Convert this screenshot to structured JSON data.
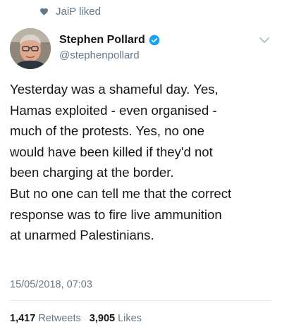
{
  "social_context": {
    "icon": "heart-icon",
    "text": "JaiP liked"
  },
  "author": {
    "name": "Stephen Pollard",
    "handle": "@stephenpollard",
    "verified": true,
    "verified_color": "#1da1f2"
  },
  "tweet": {
    "lines": [
      "Yesterday was a shameful day. Yes,",
      "Hamas exploited - even organised -",
      "much of the protests. Yes, no one",
      "would have been killed if they'd not",
      "been charging at the border.",
      "But no one can tell me that the correct",
      "response was to fire live ammunition",
      "at unarmed Palestinians."
    ],
    "timestamp": "15/05/2018, 07:03"
  },
  "stats": {
    "retweets_count": "1,417",
    "retweets_label": "Retweets",
    "likes_count": "3,905",
    "likes_label": "Likes"
  }
}
